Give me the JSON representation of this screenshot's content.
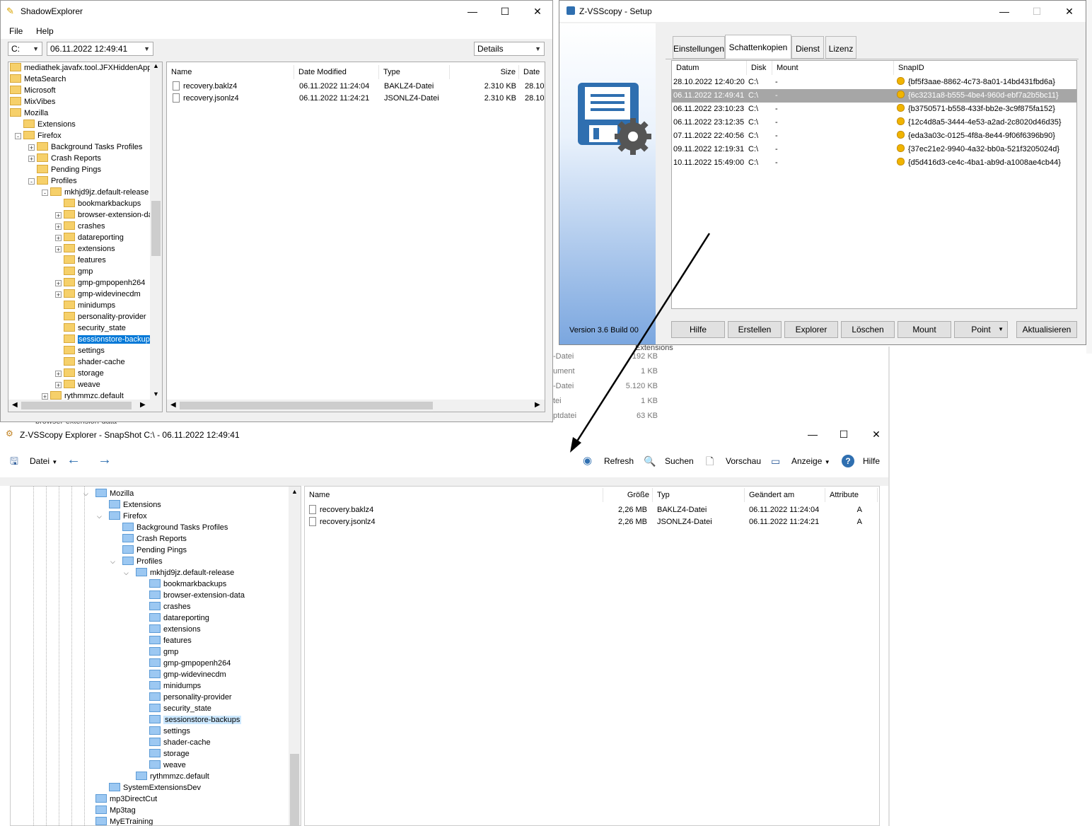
{
  "shadow": {
    "title": "ShadowExplorer",
    "menu": [
      "File",
      "Help"
    ],
    "drive": "C:",
    "date": "06.11.2022 12:49:41",
    "view": "Details",
    "tree": [
      {
        "label": "mediathek.javafx.tool.JFXHiddenApplic",
        "level": 0,
        "exp": ""
      },
      {
        "label": "MetaSearch",
        "level": 0,
        "exp": ""
      },
      {
        "label": "Microsoft",
        "level": 0,
        "exp": ""
      },
      {
        "label": "MixVibes",
        "level": 0,
        "exp": ""
      },
      {
        "label": "Mozilla",
        "level": 0,
        "exp": ""
      },
      {
        "label": "Extensions",
        "level": 1,
        "exp": ""
      },
      {
        "label": "Firefox",
        "level": 1,
        "exp": "-"
      },
      {
        "label": "Background Tasks Profiles",
        "level": 2,
        "exp": "+"
      },
      {
        "label": "Crash Reports",
        "level": 2,
        "exp": "+"
      },
      {
        "label": "Pending Pings",
        "level": 2,
        "exp": ""
      },
      {
        "label": "Profiles",
        "level": 2,
        "exp": "-"
      },
      {
        "label": "mkhjd9jz.default-release",
        "level": 3,
        "exp": "-"
      },
      {
        "label": "bookmarkbackups",
        "level": 4,
        "exp": ""
      },
      {
        "label": "browser-extension-data",
        "level": 4,
        "exp": "+"
      },
      {
        "label": "crashes",
        "level": 4,
        "exp": "+"
      },
      {
        "label": "datareporting",
        "level": 4,
        "exp": "+"
      },
      {
        "label": "extensions",
        "level": 4,
        "exp": "+"
      },
      {
        "label": "features",
        "level": 4,
        "exp": ""
      },
      {
        "label": "gmp",
        "level": 4,
        "exp": ""
      },
      {
        "label": "gmp-gmpopenh264",
        "level": 4,
        "exp": "+"
      },
      {
        "label": "gmp-widevinecdm",
        "level": 4,
        "exp": "+"
      },
      {
        "label": "minidumps",
        "level": 4,
        "exp": ""
      },
      {
        "label": "personality-provider",
        "level": 4,
        "exp": ""
      },
      {
        "label": "security_state",
        "level": 4,
        "exp": ""
      },
      {
        "label": "sessionstore-backups",
        "level": 4,
        "exp": "",
        "selected": true
      },
      {
        "label": "settings",
        "level": 4,
        "exp": ""
      },
      {
        "label": "shader-cache",
        "level": 4,
        "exp": ""
      },
      {
        "label": "storage",
        "level": 4,
        "exp": "+"
      },
      {
        "label": "weave",
        "level": 4,
        "exp": "+"
      },
      {
        "label": "rythmmzc.default",
        "level": 3,
        "exp": "+"
      }
    ],
    "columns": [
      "Name",
      "Date Modified",
      "Type",
      "Size",
      "Date"
    ],
    "files": [
      {
        "name": "recovery.baklz4",
        "date": "06.11.2022 11:24:04",
        "type": "BAKLZ4-Datei",
        "size": "2.310 KB",
        "date2": "28.10"
      },
      {
        "name": "recovery.jsonlz4",
        "date": "06.11.2022 11:24:21",
        "type": "JSONLZ4-Datei",
        "size": "2.310 KB",
        "date2": "28.10"
      }
    ]
  },
  "setup": {
    "title": "Z-VSScopy - Setup",
    "version": "Version 3.6 Build 00",
    "tabs": [
      "Einstellungen",
      "Schattenkopien",
      "Dienst",
      "Lizenz"
    ],
    "columns": [
      "Datum",
      "Disk",
      "Mount",
      "SnapID"
    ],
    "rows": [
      {
        "datum": "28.10.2022 12:40:20",
        "disk": "C:\\",
        "mount": "-",
        "snap": "{bf5f3aae-8862-4c73-8a01-14bd431fbd6a}"
      },
      {
        "datum": "06.11.2022 12:49:41",
        "disk": "C:\\",
        "mount": "-",
        "snap": "{6c3231a8-b555-4be4-960d-ebf7a2b5bc11}",
        "selected": true
      },
      {
        "datum": "06.11.2022 23:10:23",
        "disk": "C:\\",
        "mount": "-",
        "snap": "{b3750571-b558-433f-bb2e-3c9f875fa152}"
      },
      {
        "datum": "06.11.2022 23:12:35",
        "disk": "C:\\",
        "mount": "-",
        "snap": "{12c4d8a5-3444-4e53-a2ad-2c8020d46d35}"
      },
      {
        "datum": "07.11.2022 22:40:56",
        "disk": "C:\\",
        "mount": "-",
        "snap": "{eda3a03c-0125-4f8a-8e44-9f06f6396b90}"
      },
      {
        "datum": "09.11.2022 12:19:31",
        "disk": "C:\\",
        "mount": "-",
        "snap": "{37ec21e2-9940-4a32-bb0a-521f3205024d}"
      },
      {
        "datum": "10.11.2022 15:49:00",
        "disk": "C:\\",
        "mount": "-",
        "snap": "{d5d416d3-ce4c-4ba1-ab9d-a1008ae4cb44}"
      }
    ],
    "buttons": [
      "Hilfe",
      "Erstellen",
      "Explorer",
      "Löschen",
      "Mount",
      "Point",
      "Aktualisieren"
    ]
  },
  "background": {
    "rows": [
      {
        "type": "-Datei",
        "size": "192 KB"
      },
      {
        "type": "ument",
        "size": "1 KB"
      },
      {
        "type": "-Datei",
        "size": "5.120 KB"
      },
      {
        "type": "tei",
        "size": "1 KB"
      },
      {
        "type": "ptdatei",
        "size": "63 KB"
      }
    ],
    "ext_label": "Extensions",
    "bottom_label": "browser-extension-data"
  },
  "zexp": {
    "title": "Z-VSScopy Explorer - SnapShot C:\\ - 06.11.2022 12:49:41",
    "toolbar": {
      "datei": "Datei",
      "refresh": "Refresh",
      "suchen": "Suchen",
      "vorschau": "Vorschau",
      "anzeige": "Anzeige",
      "hilfe": "Hilfe"
    },
    "tree": [
      {
        "label": "Mozilla",
        "level": 0,
        "exp": "v"
      },
      {
        "label": "Extensions",
        "level": 1,
        "exp": ""
      },
      {
        "label": "Firefox",
        "level": 1,
        "exp": "v"
      },
      {
        "label": "Background Tasks Profiles",
        "level": 2,
        "exp": ""
      },
      {
        "label": "Crash Reports",
        "level": 2,
        "exp": ""
      },
      {
        "label": "Pending Pings",
        "level": 2,
        "exp": ""
      },
      {
        "label": "Profiles",
        "level": 2,
        "exp": "v"
      },
      {
        "label": "mkhjd9jz.default-release",
        "level": 3,
        "exp": "v"
      },
      {
        "label": "bookmarkbackups",
        "level": 4,
        "exp": ""
      },
      {
        "label": "browser-extension-data",
        "level": 4,
        "exp": ""
      },
      {
        "label": "crashes",
        "level": 4,
        "exp": ""
      },
      {
        "label": "datareporting",
        "level": 4,
        "exp": ""
      },
      {
        "label": "extensions",
        "level": 4,
        "exp": ""
      },
      {
        "label": "features",
        "level": 4,
        "exp": ""
      },
      {
        "label": "gmp",
        "level": 4,
        "exp": ""
      },
      {
        "label": "gmp-gmpopenh264",
        "level": 4,
        "exp": ""
      },
      {
        "label": "gmp-widevinecdm",
        "level": 4,
        "exp": ""
      },
      {
        "label": "minidumps",
        "level": 4,
        "exp": ""
      },
      {
        "label": "personality-provider",
        "level": 4,
        "exp": ""
      },
      {
        "label": "security_state",
        "level": 4,
        "exp": ""
      },
      {
        "label": "sessionstore-backups",
        "level": 4,
        "exp": "",
        "selected": true
      },
      {
        "label": "settings",
        "level": 4,
        "exp": ""
      },
      {
        "label": "shader-cache",
        "level": 4,
        "exp": ""
      },
      {
        "label": "storage",
        "level": 4,
        "exp": ""
      },
      {
        "label": "weave",
        "level": 4,
        "exp": ""
      },
      {
        "label": "rythmmzc.default",
        "level": 3,
        "exp": ""
      },
      {
        "label": "SystemExtensionsDev",
        "level": 1,
        "exp": ""
      },
      {
        "label": "mp3DirectCut",
        "level": 0,
        "exp": ""
      },
      {
        "label": "Mp3tag",
        "level": 0,
        "exp": ""
      },
      {
        "label": "MyETraining",
        "level": 0,
        "exp": ""
      }
    ],
    "columns": [
      "Name",
      "Größe",
      "Typ",
      "Geändert am",
      "Attribute"
    ],
    "files": [
      {
        "name": "recovery.baklz4",
        "size": "2,26 MB",
        "type": "BAKLZ4-Datei",
        "date": "06.11.2022 11:24:04",
        "attr": "A"
      },
      {
        "name": "recovery.jsonlz4",
        "size": "2,26 MB",
        "type": "JSONLZ4-Datei",
        "date": "06.11.2022 11:24:21",
        "attr": "A"
      }
    ]
  }
}
